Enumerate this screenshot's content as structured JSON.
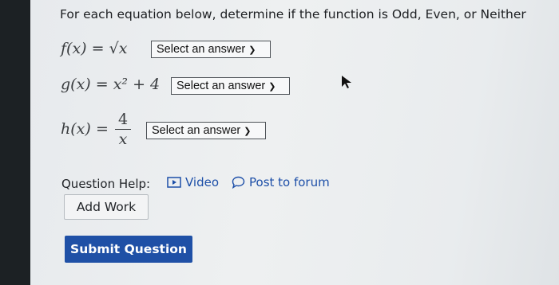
{
  "prompt": "For each equation below, determine if the function is Odd, Even, or Neither",
  "equations": [
    {
      "lhs": "f(x)",
      "rhs": "√x",
      "dropdown": "Select an answer"
    },
    {
      "lhs": "g(x)",
      "rhs": "x² + 4",
      "dropdown": "Select an answer"
    },
    {
      "lhs": "h(x)",
      "numerator": "4",
      "denominator": "x",
      "dropdown": "Select an answer"
    }
  ],
  "help": {
    "label": "Question Help:",
    "video": "Video",
    "forum": "Post to forum"
  },
  "buttons": {
    "add_work": "Add Work",
    "submit": "Submit Question"
  },
  "colors": {
    "link": "#1d4fa8",
    "submit_bg": "#1f50a6"
  }
}
